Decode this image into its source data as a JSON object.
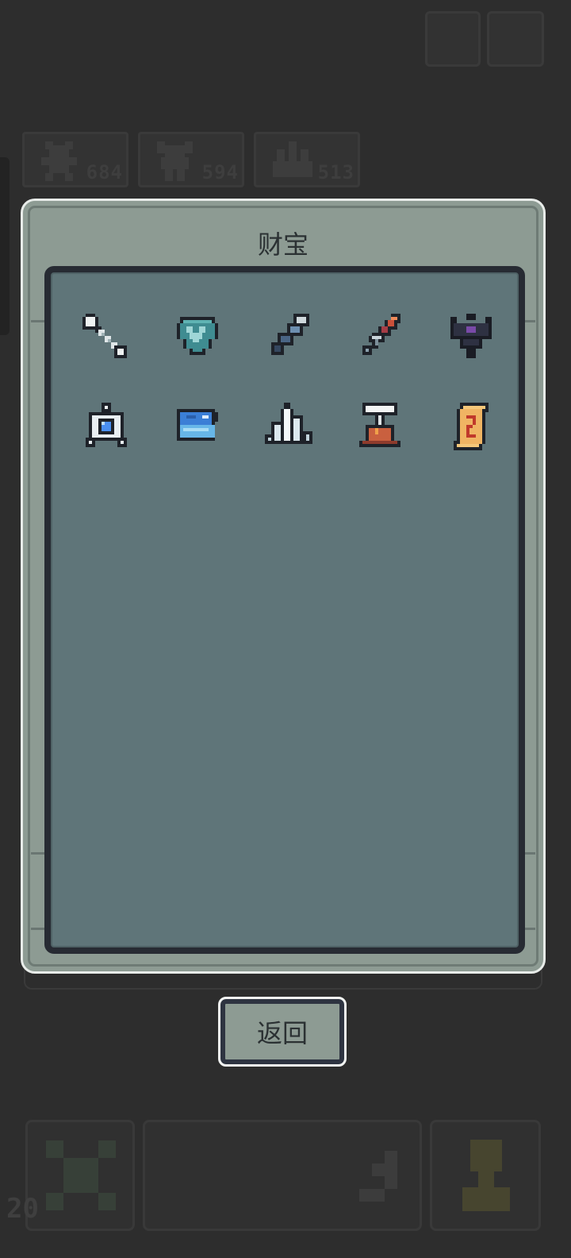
{
  "panel": {
    "title": "财宝"
  },
  "back_button": {
    "label": "返回"
  },
  "background": {
    "stats": [
      {
        "icon": "warrior-icon",
        "value": "684"
      },
      {
        "icon": "knight-icon",
        "value": "594"
      },
      {
        "icon": "hand-icon",
        "value": "513"
      }
    ],
    "level": "20"
  },
  "treasures": [
    {
      "icon": "bone-icon"
    },
    {
      "icon": "heart-gem-icon"
    },
    {
      "icon": "spyglass-icon"
    },
    {
      "icon": "dagger-icon"
    },
    {
      "icon": "dark-crown-icon"
    },
    {
      "icon": "blue-amulet-icon"
    },
    {
      "icon": "blue-fish-icon"
    },
    {
      "icon": "ice-crystal-icon"
    },
    {
      "icon": "volcano-icon"
    },
    {
      "icon": "scroll-icon"
    }
  ],
  "colors": {
    "background": "#2d2d2d",
    "panel_frame": "#8d9b93",
    "panel_inner": "#5f7579",
    "border_dark": "#272b33"
  }
}
